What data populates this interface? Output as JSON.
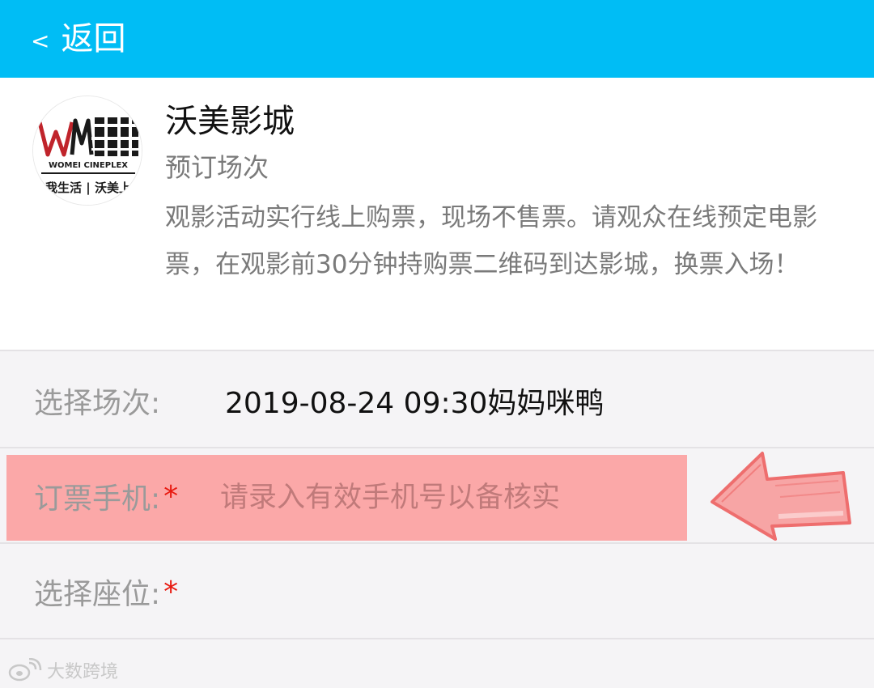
{
  "topbar": {
    "back_label": "返回",
    "back_chevron": "<",
    "color": "#00bdf5"
  },
  "cinema": {
    "name": "沃美影城",
    "subtitle": "预订场次",
    "notice": "观影活动实行线上购票，现场不售票。请观众在线预定电影票，在观影前30分钟持购票二维码到达影城，换票入场！",
    "logo": {
      "icon": "cinema-logo-icon",
      "brand_cn": "沃美影城",
      "brand_en": "WOMEI CINEPLEX",
      "slogan": "为我生活 | 沃美上映"
    }
  },
  "form": {
    "session": {
      "label": "选择场次:",
      "value": "2019-08-24 09:30妈妈咪鸭"
    },
    "phone": {
      "label": "订票手机:",
      "required_mark": "*",
      "placeholder": "请录入有效手机号以备核实",
      "value": "",
      "highlight_color": "#fba8a8"
    },
    "seat": {
      "label": "选择座位:",
      "required_mark": "*"
    }
  },
  "annotation": {
    "icon": "pointing-arrow-icon",
    "color": "#f07878"
  },
  "watermark": {
    "text": "大数跨境",
    "icon": "weibo-logo-icon"
  }
}
